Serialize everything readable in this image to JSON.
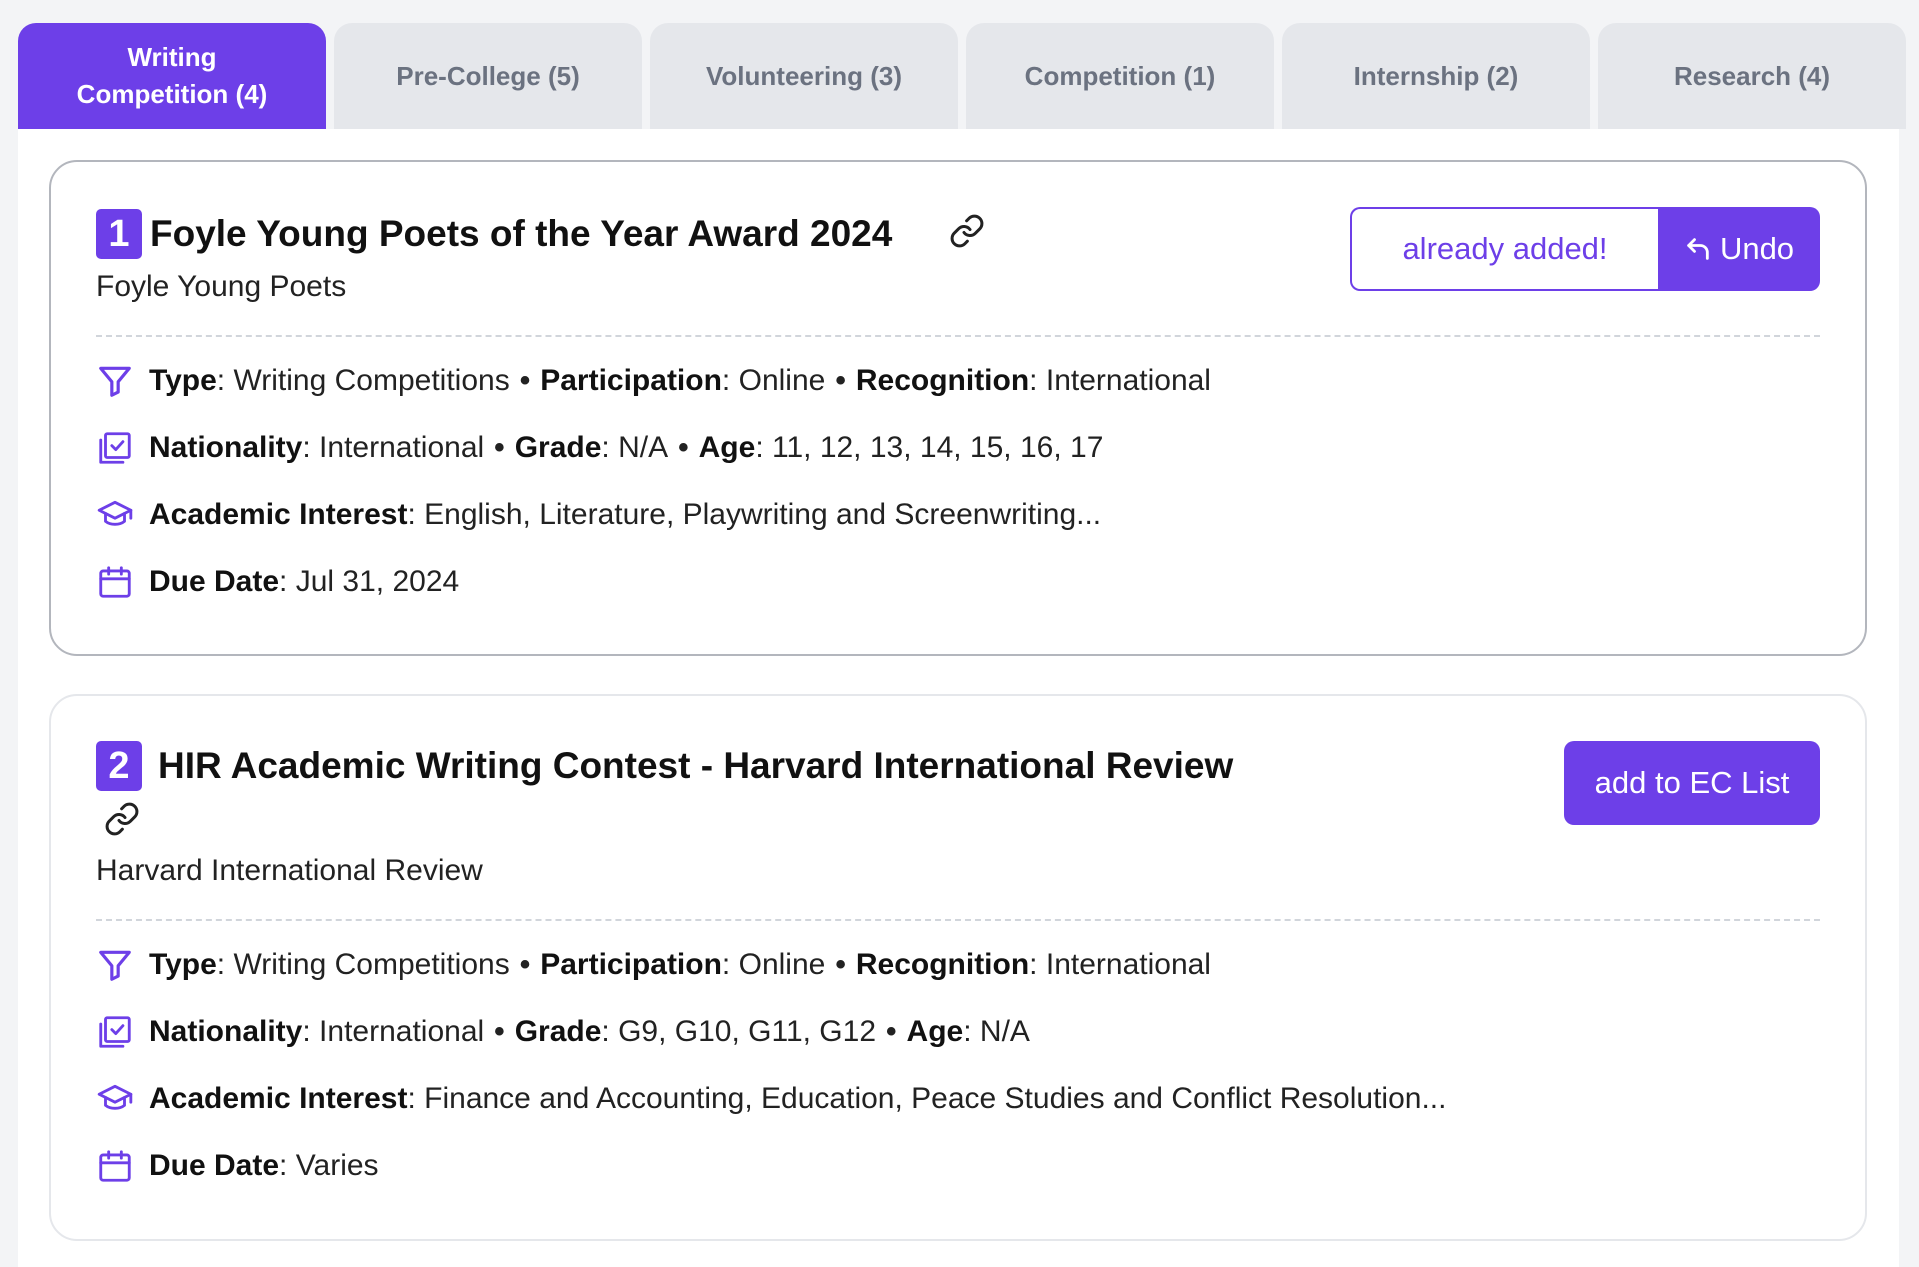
{
  "tabs": [
    {
      "label": "Writing Competition (4)",
      "active": true
    },
    {
      "label": "Pre-College (5)",
      "active": false
    },
    {
      "label": "Volunteering (3)",
      "active": false
    },
    {
      "label": "Competition (1)",
      "active": false
    },
    {
      "label": "Internship (2)",
      "active": false
    },
    {
      "label": "Research (4)",
      "active": false
    }
  ],
  "labels": {
    "type": "Type",
    "participation": "Participation",
    "recognition": "Recognition",
    "nationality": "Nationality",
    "grade": "Grade",
    "age": "Age",
    "academic_interest": "Academic Interest",
    "due_date": "Due Date",
    "separator": "•",
    "colon": ":"
  },
  "cards": [
    {
      "number": "1",
      "title": "Foyle Young Poets of the Year Award 2024",
      "organization": "Foyle Young Poets",
      "added_label": "already added!",
      "undo_label": "Undo",
      "type": "Writing Competitions",
      "participation": "Online",
      "recognition": "International",
      "nationality": "International",
      "grade": "N/A",
      "age": "11, 12, 13, 14, 15, 16, 17",
      "academic_interest": "English, Literature, Playwriting and Screenwriting...",
      "due_date": "Jul 31, 2024"
    },
    {
      "number": "2",
      "title": "HIR Academic Writing Contest - Harvard International Review",
      "organization": "Harvard International Review",
      "add_label": "add to EC List",
      "type": "Writing Competitions",
      "participation": "Online",
      "recognition": "International",
      "nationality": "International",
      "grade": "G9, G10, G11, G12",
      "age": "N/A",
      "academic_interest": "Finance and Accounting, Education, Peace Studies and Conflict Resolution...",
      "due_date": "Varies"
    }
  ],
  "colors": {
    "accent": "#6d3fe8",
    "tab_inactive_bg": "#e5e7eb",
    "tab_inactive_text": "#6b7280",
    "page_bg": "#f3f4f6"
  },
  "icons": [
    "filter-icon",
    "checklist-icon",
    "graduation-cap-icon",
    "calendar-icon",
    "link-icon",
    "undo-arrow-icon"
  ]
}
